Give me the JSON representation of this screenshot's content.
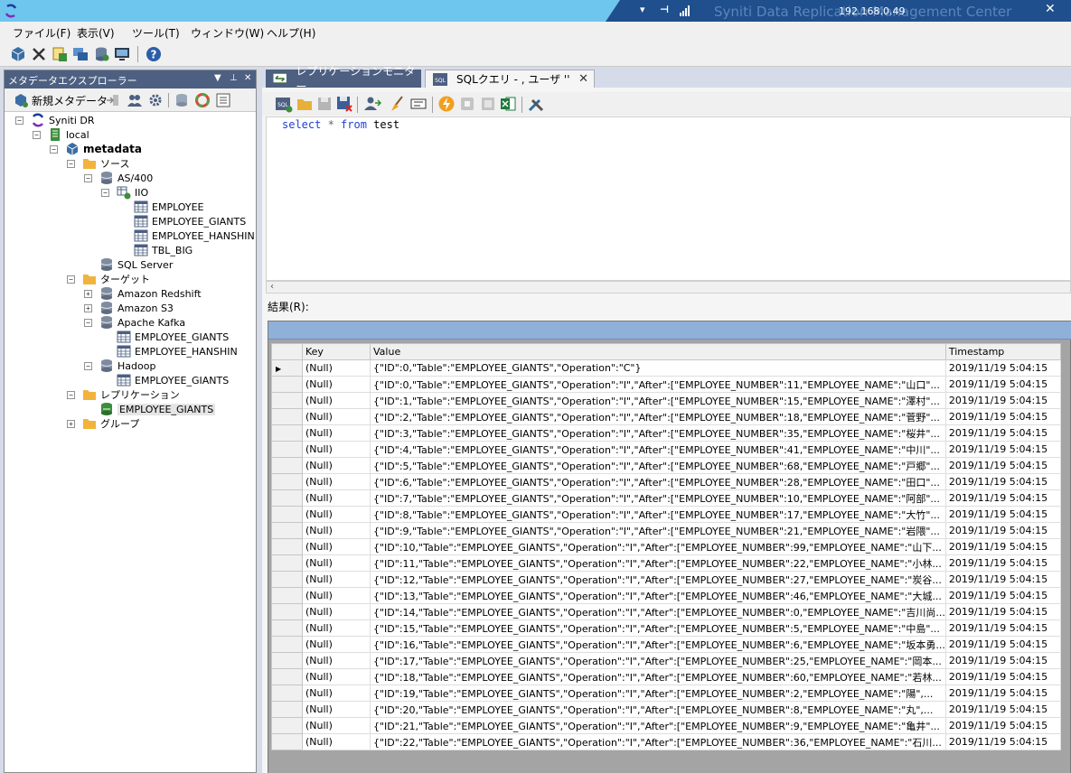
{
  "window": {
    "remote_ip": "192.168.0.49",
    "title": "Syniti Data Replication Management Center"
  },
  "menu": [
    "ファイル(F)",
    "表示(V)",
    "ツール(T)",
    "ウィンドウ(W)",
    "ヘルプ(H)"
  ],
  "explorer": {
    "title": "メタデータエクスプローラー",
    "new_button": "新規メタデータ",
    "tree": [
      {
        "label": "Syniti DR",
        "level": 0,
        "exp": "−",
        "icon": "syniti-logo-icon"
      },
      {
        "label": "local",
        "level": 1,
        "exp": "−",
        "icon": "server-icon"
      },
      {
        "label": "metadata",
        "level": 2,
        "exp": "−",
        "icon": "cube-icon",
        "bold": true
      },
      {
        "label": "ソース",
        "level": 3,
        "exp": "−",
        "icon": "folder-icon"
      },
      {
        "label": "AS/400",
        "level": 4,
        "exp": "−",
        "icon": "database-icon"
      },
      {
        "label": "IIO",
        "level": 5,
        "exp": "−",
        "icon": "schema-icon"
      },
      {
        "label": "EMPLOYEE",
        "level": 6,
        "exp": "",
        "icon": "table-icon"
      },
      {
        "label": "EMPLOYEE_GIANTS",
        "level": 6,
        "exp": "",
        "icon": "table-icon"
      },
      {
        "label": "EMPLOYEE_HANSHIN",
        "level": 6,
        "exp": "",
        "icon": "table-icon"
      },
      {
        "label": "TBL_BIG",
        "level": 6,
        "exp": "",
        "icon": "table-icon"
      },
      {
        "label": "SQL Server",
        "level": 4,
        "exp": "",
        "icon": "database-icon"
      },
      {
        "label": "ターゲット",
        "level": 3,
        "exp": "−",
        "icon": "folder-icon"
      },
      {
        "label": "Amazon Redshift",
        "level": 4,
        "exp": "+",
        "icon": "database-icon"
      },
      {
        "label": "Amazon S3",
        "level": 4,
        "exp": "+",
        "icon": "database-icon"
      },
      {
        "label": "Apache Kafka",
        "level": 4,
        "exp": "−",
        "icon": "database-icon"
      },
      {
        "label": "EMPLOYEE_GIANTS",
        "level": 5,
        "exp": "",
        "icon": "table-icon"
      },
      {
        "label": "EMPLOYEE_HANSHIN",
        "level": 5,
        "exp": "",
        "icon": "table-icon"
      },
      {
        "label": "Hadoop",
        "level": 4,
        "exp": "−",
        "icon": "database-icon"
      },
      {
        "label": "EMPLOYEE_GIANTS",
        "level": 5,
        "exp": "",
        "icon": "table-icon"
      },
      {
        "label": "レプリケーション",
        "level": 3,
        "exp": "−",
        "icon": "folder-icon"
      },
      {
        "label": "EMPLOYEE_GIANTS",
        "level": 4,
        "exp": "",
        "icon": "replication-icon",
        "selected": true
      },
      {
        "label": "グループ",
        "level": 3,
        "exp": "+",
        "icon": "folder-icon"
      }
    ]
  },
  "tabs": [
    {
      "label": "レプリケーションモニター",
      "active": false
    },
    {
      "label": "SQLクエリ - , ユーザ ''",
      "active": true
    }
  ],
  "sql": {
    "query_keyword1": "select",
    "query_star": " * ",
    "query_keyword2": "from",
    "query_table": " test"
  },
  "results": {
    "label": "結果(R):",
    "columns": [
      "Key",
      "Value",
      "Timestamp"
    ],
    "rows": [
      {
        "key": "(Null)",
        "value": "{\"ID\":0,\"Table\":\"EMPLOYEE_GIANTS\",\"Operation\":\"C\"}",
        "ts": "2019/11/19 5:04:15",
        "current": true
      },
      {
        "key": "(Null)",
        "value": "{\"ID\":0,\"Table\":\"EMPLOYEE_GIANTS\",\"Operation\":\"I\",\"After\":[\"EMPLOYEE_NUMBER\":11,\"EMPLOYEE_NAME\":\"山口\"...",
        "ts": "2019/11/19 5:04:15"
      },
      {
        "key": "(Null)",
        "value": "{\"ID\":1,\"Table\":\"EMPLOYEE_GIANTS\",\"Operation\":\"I\",\"After\":[\"EMPLOYEE_NUMBER\":15,\"EMPLOYEE_NAME\":\"澤村\"...",
        "ts": "2019/11/19 5:04:15"
      },
      {
        "key": "(Null)",
        "value": "{\"ID\":2,\"Table\":\"EMPLOYEE_GIANTS\",\"Operation\":\"I\",\"After\":[\"EMPLOYEE_NUMBER\":18,\"EMPLOYEE_NAME\":\"菅野\"...",
        "ts": "2019/11/19 5:04:15"
      },
      {
        "key": "(Null)",
        "value": "{\"ID\":3,\"Table\":\"EMPLOYEE_GIANTS\",\"Operation\":\"I\",\"After\":[\"EMPLOYEE_NUMBER\":35,\"EMPLOYEE_NAME\":\"桜井\"...",
        "ts": "2019/11/19 5:04:15"
      },
      {
        "key": "(Null)",
        "value": "{\"ID\":4,\"Table\":\"EMPLOYEE_GIANTS\",\"Operation\":\"I\",\"After\":[\"EMPLOYEE_NUMBER\":41,\"EMPLOYEE_NAME\":\"中川\"...",
        "ts": "2019/11/19 5:04:15"
      },
      {
        "key": "(Null)",
        "value": "{\"ID\":5,\"Table\":\"EMPLOYEE_GIANTS\",\"Operation\":\"I\",\"After\":[\"EMPLOYEE_NUMBER\":68,\"EMPLOYEE_NAME\":\"戸郷\"...",
        "ts": "2019/11/19 5:04:15"
      },
      {
        "key": "(Null)",
        "value": "{\"ID\":6,\"Table\":\"EMPLOYEE_GIANTS\",\"Operation\":\"I\",\"After\":[\"EMPLOYEE_NUMBER\":28,\"EMPLOYEE_NAME\":\"田口\"...",
        "ts": "2019/11/19 5:04:15"
      },
      {
        "key": "(Null)",
        "value": "{\"ID\":7,\"Table\":\"EMPLOYEE_GIANTS\",\"Operation\":\"I\",\"After\":[\"EMPLOYEE_NUMBER\":10,\"EMPLOYEE_NAME\":\"阿部\"...",
        "ts": "2019/11/19 5:04:15"
      },
      {
        "key": "(Null)",
        "value": "{\"ID\":8,\"Table\":\"EMPLOYEE_GIANTS\",\"Operation\":\"I\",\"After\":[\"EMPLOYEE_NUMBER\":17,\"EMPLOYEE_NAME\":\"大竹\"...",
        "ts": "2019/11/19 5:04:15"
      },
      {
        "key": "(Null)",
        "value": "{\"ID\":9,\"Table\":\"EMPLOYEE_GIANTS\",\"Operation\":\"I\",\"After\":[\"EMPLOYEE_NUMBER\":21,\"EMPLOYEE_NAME\":\"岩隈\"...",
        "ts": "2019/11/19 5:04:15"
      },
      {
        "key": "(Null)",
        "value": "{\"ID\":10,\"Table\":\"EMPLOYEE_GIANTS\",\"Operation\":\"I\",\"After\":[\"EMPLOYEE_NUMBER\":99,\"EMPLOYEE_NAME\":\"山下...",
        "ts": "2019/11/19 5:04:15"
      },
      {
        "key": "(Null)",
        "value": "{\"ID\":11,\"Table\":\"EMPLOYEE_GIANTS\",\"Operation\":\"I\",\"After\":[\"EMPLOYEE_NUMBER\":22,\"EMPLOYEE_NAME\":\"小林...",
        "ts": "2019/11/19 5:04:15"
      },
      {
        "key": "(Null)",
        "value": "{\"ID\":12,\"Table\":\"EMPLOYEE_GIANTS\",\"Operation\":\"I\",\"After\":[\"EMPLOYEE_NUMBER\":27,\"EMPLOYEE_NAME\":\"炭谷...",
        "ts": "2019/11/19 5:04:15"
      },
      {
        "key": "(Null)",
        "value": "{\"ID\":13,\"Table\":\"EMPLOYEE_GIANTS\",\"Operation\":\"I\",\"After\":[\"EMPLOYEE_NUMBER\":46,\"EMPLOYEE_NAME\":\"大城...",
        "ts": "2019/11/19 5:04:15"
      },
      {
        "key": "(Null)",
        "value": "{\"ID\":14,\"Table\":\"EMPLOYEE_GIANTS\",\"Operation\":\"I\",\"After\":[\"EMPLOYEE_NUMBER\":0,\"EMPLOYEE_NAME\":\"吉川尚...",
        "ts": "2019/11/19 5:04:15"
      },
      {
        "key": "(Null)",
        "value": "{\"ID\":15,\"Table\":\"EMPLOYEE_GIANTS\",\"Operation\":\"I\",\"After\":[\"EMPLOYEE_NUMBER\":5,\"EMPLOYEE_NAME\":\"中島\"...",
        "ts": "2019/11/19 5:04:15"
      },
      {
        "key": "(Null)",
        "value": "{\"ID\":16,\"Table\":\"EMPLOYEE_GIANTS\",\"Operation\":\"I\",\"After\":[\"EMPLOYEE_NUMBER\":6,\"EMPLOYEE_NAME\":\"坂本勇...",
        "ts": "2019/11/19 5:04:15"
      },
      {
        "key": "(Null)",
        "value": "{\"ID\":17,\"Table\":\"EMPLOYEE_GIANTS\",\"Operation\":\"I\",\"After\":[\"EMPLOYEE_NUMBER\":25,\"EMPLOYEE_NAME\":\"岡本...",
        "ts": "2019/11/19 5:04:15"
      },
      {
        "key": "(Null)",
        "value": "{\"ID\":18,\"Table\":\"EMPLOYEE_GIANTS\",\"Operation\":\"I\",\"After\":[\"EMPLOYEE_NUMBER\":60,\"EMPLOYEE_NAME\":\"若林...",
        "ts": "2019/11/19 5:04:15"
      },
      {
        "key": "(Null)",
        "value": "{\"ID\":19,\"Table\":\"EMPLOYEE_GIANTS\",\"Operation\":\"I\",\"After\":[\"EMPLOYEE_NUMBER\":2,\"EMPLOYEE_NAME\":\"陽\",...",
        "ts": "2019/11/19 5:04:15"
      },
      {
        "key": "(Null)",
        "value": "{\"ID\":20,\"Table\":\"EMPLOYEE_GIANTS\",\"Operation\":\"I\",\"After\":[\"EMPLOYEE_NUMBER\":8,\"EMPLOYEE_NAME\":\"丸\",...",
        "ts": "2019/11/19 5:04:15"
      },
      {
        "key": "(Null)",
        "value": "{\"ID\":21,\"Table\":\"EMPLOYEE_GIANTS\",\"Operation\":\"I\",\"After\":[\"EMPLOYEE_NUMBER\":9,\"EMPLOYEE_NAME\":\"亀井\"...",
        "ts": "2019/11/19 5:04:15"
      },
      {
        "key": "(Null)",
        "value": "{\"ID\":22,\"Table\":\"EMPLOYEE_GIANTS\",\"Operation\":\"I\",\"After\":[\"EMPLOYEE_NUMBER\":36,\"EMPLOYEE_NAME\":\"石川...",
        "ts": "2019/11/19 5:04:15"
      }
    ]
  }
}
